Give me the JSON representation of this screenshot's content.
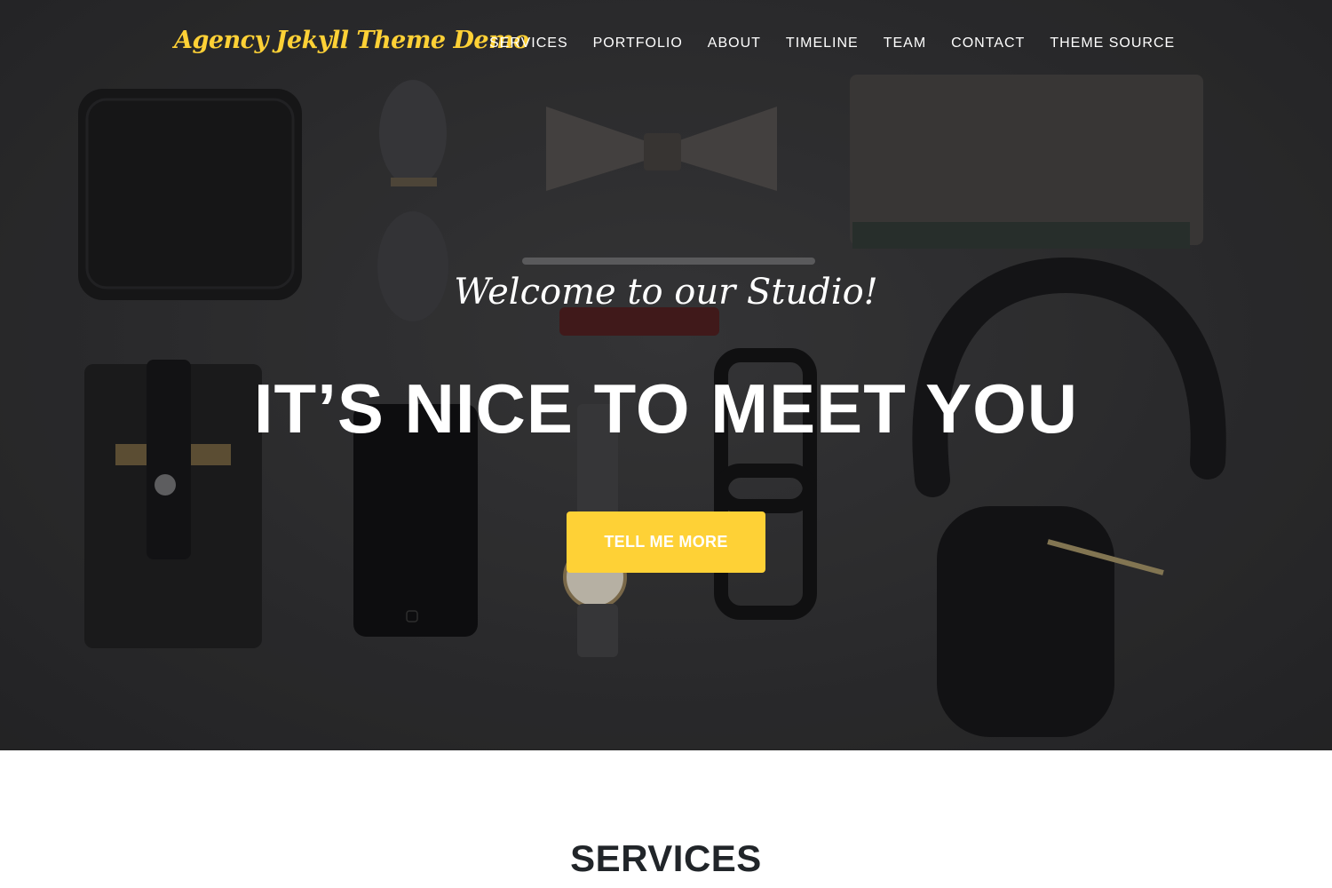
{
  "nav": {
    "brand": "Agency Jekyll Theme Demo",
    "links": [
      "SERVICES",
      "PORTFOLIO",
      "ABOUT",
      "TIMELINE",
      "TEAM",
      "CONTACT",
      "THEME SOURCE"
    ]
  },
  "hero": {
    "subtitle": "Welcome to our Studio!",
    "title": "IT’S NICE TO MEET YOU",
    "button_label": "TELL ME MORE",
    "background_image": "flat-lay-accessories-photo"
  },
  "sections": {
    "services_heading": "SERVICES"
  },
  "colors": {
    "accent": "#fed136",
    "heading_dark": "#212529"
  }
}
